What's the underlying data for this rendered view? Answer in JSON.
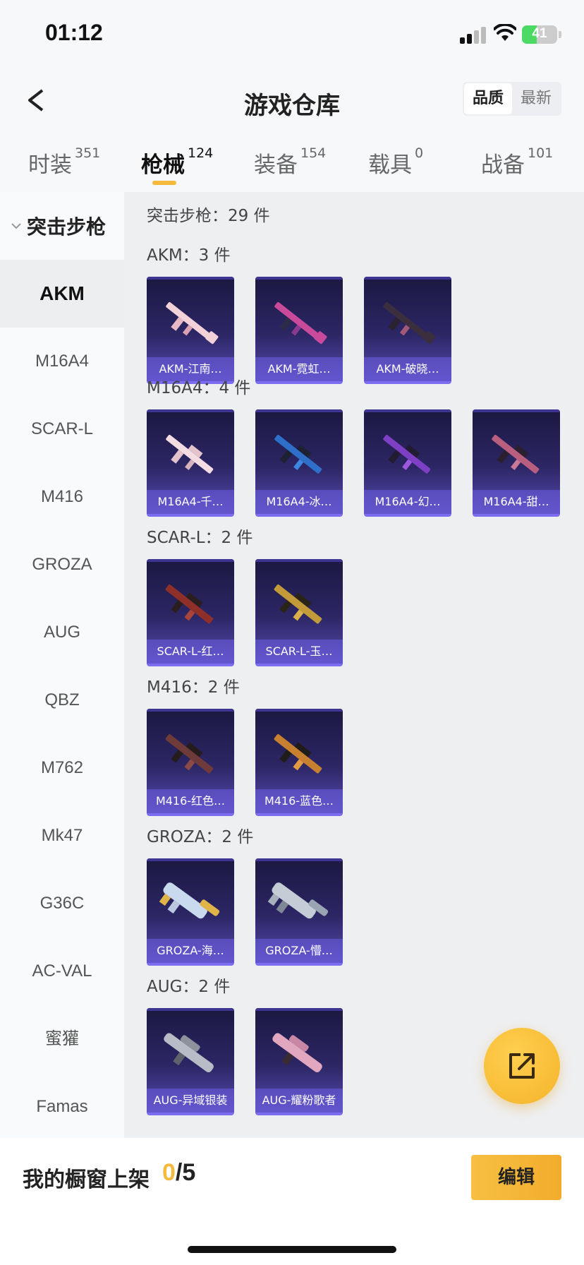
{
  "status_bar": {
    "time": "01:12",
    "battery": "41",
    "battery_level": 0.41
  },
  "header": {
    "title": "游戏仓库",
    "sort_options": [
      "品质",
      "最新"
    ],
    "sort_selected": "品质"
  },
  "tabs": [
    {
      "label": "时装",
      "count": "351"
    },
    {
      "label": "枪械",
      "count": "124",
      "active": true
    },
    {
      "label": "装备",
      "count": "154"
    },
    {
      "label": "载具",
      "count": "0"
    },
    {
      "label": "战备",
      "count": "101"
    }
  ],
  "sidebar": {
    "group": "突击步枪",
    "items": [
      "AKM",
      "M16A4",
      "SCAR-L",
      "M416",
      "GROZA",
      "AUG",
      "QBZ",
      "M762",
      "Mk47",
      "G36C",
      "AC-VAL",
      "蜜獾",
      "Famas"
    ],
    "active": "AKM"
  },
  "content": {
    "section_total": "突击步枪：29 件",
    "groups": [
      {
        "title": "AKM：3 件",
        "items": [
          "AKM-江南…",
          "AKM-霓虹…",
          "AKM-破晓…"
        ]
      },
      {
        "title": "M16A4：4 件",
        "items": [
          "M16A4-千…",
          "M16A4-冰…",
          "M16A4-幻…",
          "M16A4-甜…"
        ]
      },
      {
        "title": "SCAR-L：2 件",
        "items": [
          "SCAR-L-红…",
          "SCAR-L-玉…"
        ]
      },
      {
        "title": "M416：2 件",
        "items": [
          "M416-红色…",
          "M416-蓝色…"
        ]
      },
      {
        "title": "GROZA：2 件",
        "items": [
          "GROZA-海…",
          "GROZA-懵…"
        ]
      },
      {
        "title": "AUG：2 件",
        "items": [
          "AUG-异域银装",
          "AUG-耀粉歌者"
        ]
      }
    ]
  },
  "bottom": {
    "shelf_label": "我的橱窗上架",
    "shelf_current": "0",
    "shelf_total": "/5",
    "edit_label": "编辑"
  },
  "icons": {
    "back": "back-arrow-icon",
    "share": "share-external-icon",
    "collapse": "chevron-down-icon"
  },
  "colors": {
    "accent": "#f5b93b",
    "card_bg": "#2c2665",
    "card_border": "#7b6cf0",
    "battery": "#4cd964"
  }
}
